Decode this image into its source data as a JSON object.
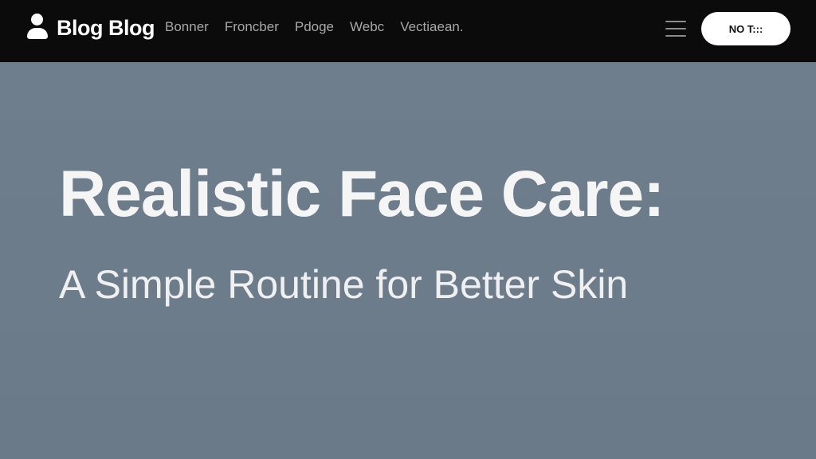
{
  "header": {
    "brand_name": "Blog Blog",
    "nav_links": [
      "Bonner",
      "Froncber",
      "Pdoge",
      "Webc",
      "Vectiaean."
    ],
    "cta_label": "NO T:::"
  },
  "hero": {
    "title": "Realistic Face Care:",
    "subtitle": "A Simple Routine for Better Skin"
  }
}
